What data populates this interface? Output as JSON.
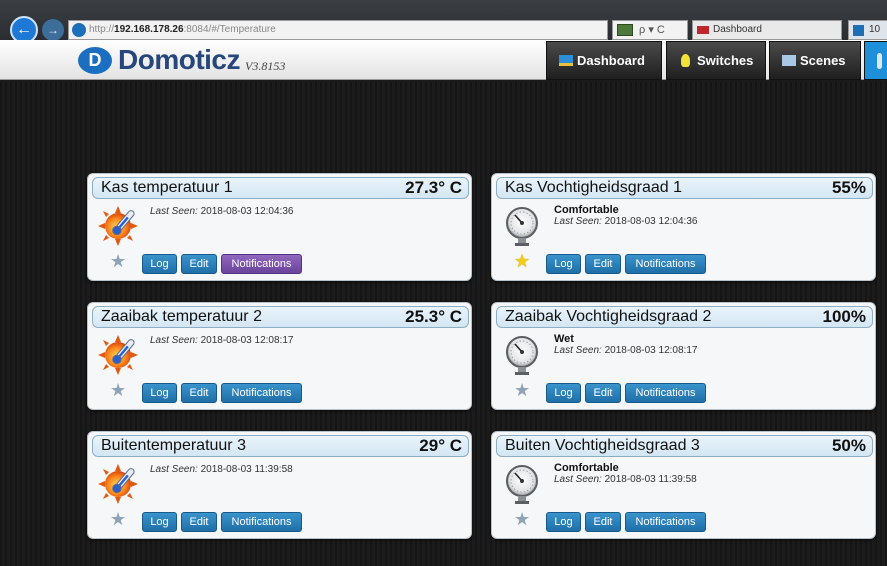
{
  "browser": {
    "back_glyph": "←",
    "forward_glyph": "→",
    "url_prefix": "http://",
    "url_host": "192.168.178.26",
    "url_rest": ":8084/#/Temperature",
    "toolbar_text": "ρ ▾ C",
    "tab_title": "Dashboard",
    "tab2_title": "10"
  },
  "header": {
    "logo_glyph": "D",
    "brand": "Domoticz",
    "version": "V3.8153"
  },
  "nav": {
    "dashboard": "Dashboard",
    "switches": "Switches",
    "scenes": "Scenes"
  },
  "labels": {
    "last_seen": "Last Seen:",
    "log": "Log",
    "edit": "Edit",
    "notifications": "Notifications"
  },
  "devices": [
    {
      "name": "Kas temperatuur 1",
      "value": "27.3° C",
      "status": "",
      "last_seen": "2018-08-03 12:04:36",
      "type": "temperature",
      "favorite": false,
      "notifications_active": true
    },
    {
      "name": "Kas Vochtigheidsgraad 1",
      "value": "55%",
      "status": "Comfortable",
      "last_seen": "2018-08-03 12:04:36",
      "type": "humidity",
      "favorite": true,
      "notifications_active": false
    },
    {
      "name": "Zaaibak temperatuur 2",
      "value": "25.3° C",
      "status": "",
      "last_seen": "2018-08-03 12:08:17",
      "type": "temperature",
      "favorite": false,
      "notifications_active": false
    },
    {
      "name": "Zaaibak Vochtigheidsgraad 2",
      "value": "100%",
      "status": "Wet",
      "last_seen": "2018-08-03 12:08:17",
      "type": "humidity",
      "favorite": false,
      "notifications_active": false
    },
    {
      "name": "Buitentemperatuur 3",
      "value": "29° C",
      "status": "",
      "last_seen": "2018-08-03 11:39:58",
      "type": "temperature",
      "favorite": false,
      "notifications_active": false
    },
    {
      "name": "Buiten Vochtigheidsgraad 3",
      "value": "50%",
      "status": "Comfortable",
      "last_seen": "2018-08-03 11:39:58",
      "type": "humidity",
      "favorite": false,
      "notifications_active": false
    }
  ],
  "icons": {
    "temperature": "thermometer-sun-icon",
    "humidity": "hygrometer-gauge-icon",
    "star": "star-icon"
  },
  "colors": {
    "button": "#1f6fa8",
    "notifications_active": "#6a439b",
    "favorite_star": "#f2cc16",
    "brand": "#26467c"
  }
}
